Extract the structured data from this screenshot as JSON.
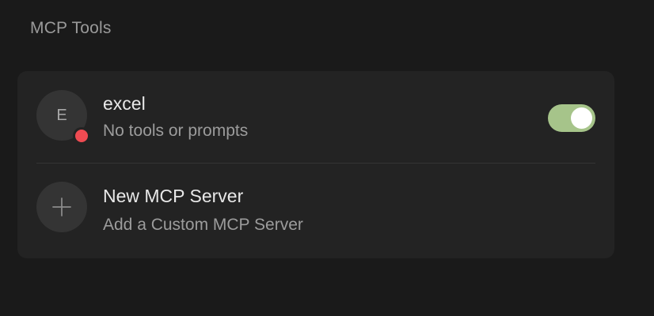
{
  "section": {
    "title": "MCP Tools"
  },
  "servers": [
    {
      "initial": "E",
      "name": "excel",
      "subtitle": "No tools or prompts",
      "status_color": "#ef4b52",
      "enabled": true,
      "toggle_on_color": "#a6c48a"
    }
  ],
  "add_server": {
    "title": "New MCP Server",
    "subtitle": "Add a Custom MCP Server",
    "icon": "plus-icon"
  }
}
